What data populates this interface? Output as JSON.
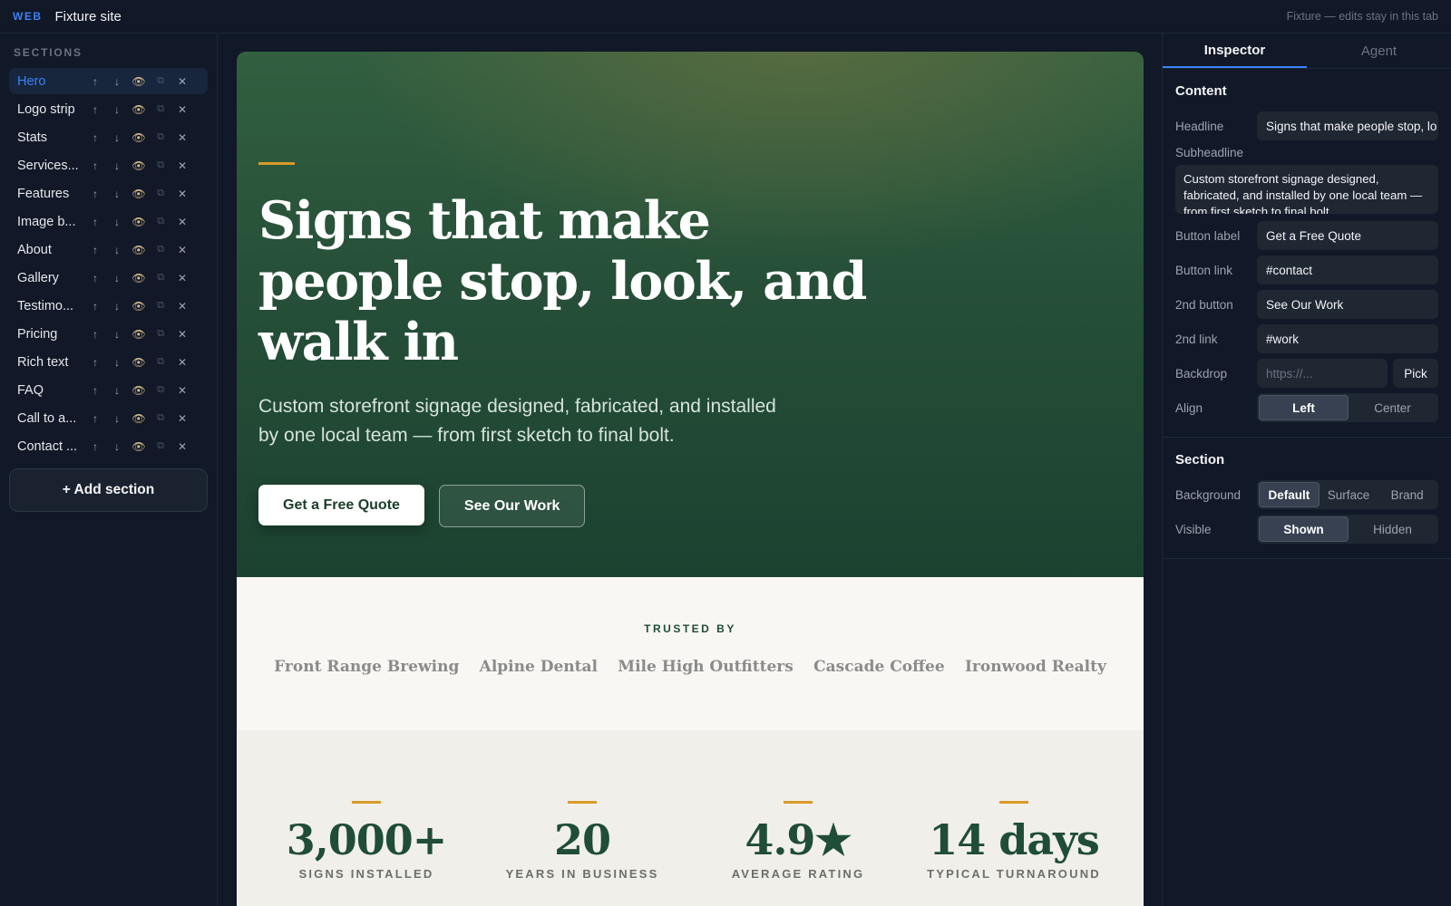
{
  "topbar": {
    "badge": "WEB",
    "site_name": "Fixture site",
    "note": "Fixture — edits stay in this tab"
  },
  "sidebar": {
    "heading": "SECTIONS",
    "items": [
      {
        "label": "Hero",
        "active": true
      },
      {
        "label": "Logo strip"
      },
      {
        "label": "Stats"
      },
      {
        "label": "Services..."
      },
      {
        "label": "Features"
      },
      {
        "label": "Image b..."
      },
      {
        "label": "About"
      },
      {
        "label": "Gallery"
      },
      {
        "label": "Testimo..."
      },
      {
        "label": "Pricing"
      },
      {
        "label": "Rich text"
      },
      {
        "label": "FAQ"
      },
      {
        "label": "Call to a..."
      },
      {
        "label": "Contact ..."
      }
    ],
    "controls": {
      "up": "↑",
      "down": "↓",
      "eye": "👁",
      "duplicate": "⧉",
      "remove": "✕"
    },
    "add_label": "+ Add section"
  },
  "hero": {
    "headline": "Signs that make people stop, look, and walk in",
    "subheadline": "Custom storefront signage designed, fabricated, and installed by one local team — from first sketch to final bolt.",
    "primary_button": "Get a Free Quote",
    "secondary_button": "See Our Work"
  },
  "logo_strip": {
    "kicker": "TRUSTED BY",
    "logos": [
      "Front Range Brewing",
      "Alpine Dental",
      "Mile High Outfitters",
      "Cascade Coffee",
      "Ironwood Realty"
    ]
  },
  "stats": [
    {
      "value": "3,000+",
      "label": "SIGNS INSTALLED"
    },
    {
      "value": "20",
      "label": "YEARS IN BUSINESS"
    },
    {
      "value": "4.9★",
      "label": "AVERAGE RATING"
    },
    {
      "value": "14 days",
      "label": "TYPICAL TURNAROUND"
    }
  ],
  "inspector": {
    "tabs": {
      "inspector": "Inspector",
      "agent": "Agent"
    },
    "content": {
      "title": "Content",
      "headline_label": "Headline",
      "headline_value": "Signs that make people stop, lo",
      "subheadline_label": "Subheadline",
      "subheadline_value": "Custom storefront signage designed, fabricated, and installed by one local team — from first sketch to final bolt.",
      "button_label_label": "Button label",
      "button_label_value": "Get a Free Quote",
      "button_link_label": "Button link",
      "button_link_value": "#contact",
      "second_button_label": "2nd button",
      "second_button_value": "See Our Work",
      "second_link_label": "2nd link",
      "second_link_value": "#work",
      "backdrop_label": "Backdrop",
      "backdrop_placeholder": "https://...",
      "pick_label": "Pick",
      "align_label": "Align",
      "align_options": [
        "Left",
        "Center"
      ],
      "align_selected": "Left"
    },
    "section": {
      "title": "Section",
      "background_label": "Background",
      "background_options": [
        "Default",
        "Surface",
        "Brand"
      ],
      "background_selected": "Default",
      "visible_label": "Visible",
      "visible_options": [
        "Shown",
        "Hidden"
      ],
      "visible_selected": "Shown"
    }
  },
  "colors": {
    "accent": "#3b82f6",
    "brand_green": "#1f4d35",
    "gold": "#d99a2b"
  }
}
